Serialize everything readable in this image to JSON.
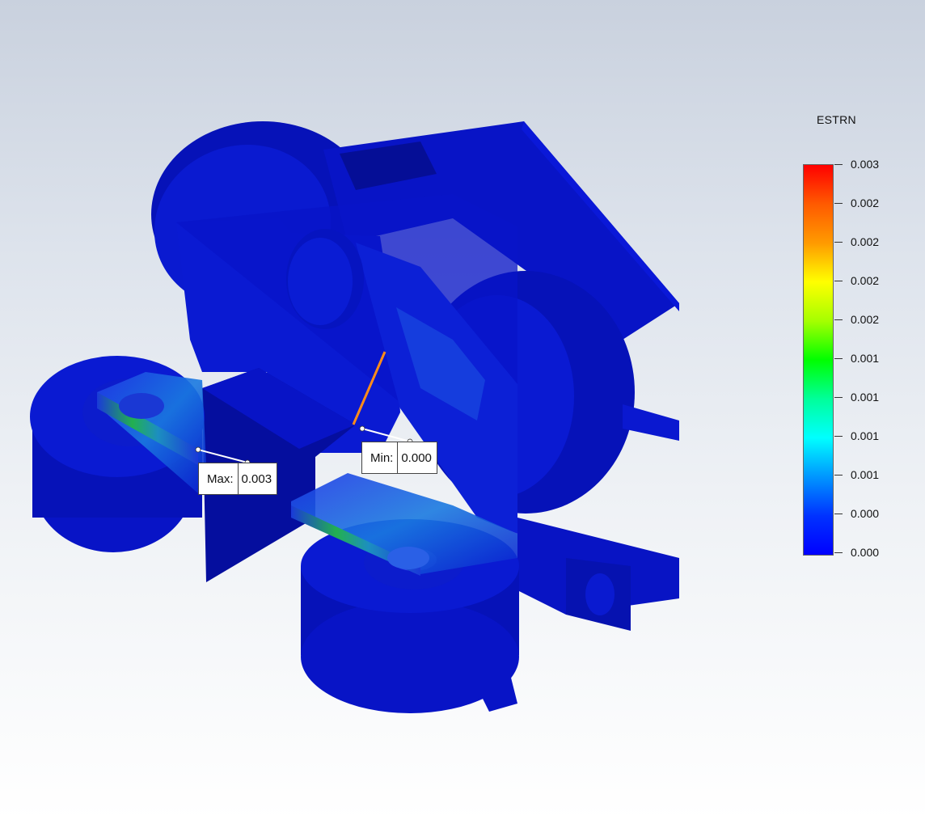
{
  "legend": {
    "title": "ESTRN",
    "ticks": [
      "0.003",
      "0.002",
      "0.002",
      "0.002",
      "0.002",
      "0.001",
      "0.001",
      "0.001",
      "0.001",
      "0.000",
      "0.000"
    ]
  },
  "probes": {
    "max": {
      "label": "Max:",
      "value": "0.003"
    },
    "min": {
      "label": "Min:",
      "value": "0.000"
    }
  },
  "colors": {
    "model_base": "#0a14c8",
    "model_dark": "#0410a8",
    "model_light": "#1a2ee0",
    "scale_top": "#ff0000",
    "scale_bottom": "#0000ff"
  }
}
